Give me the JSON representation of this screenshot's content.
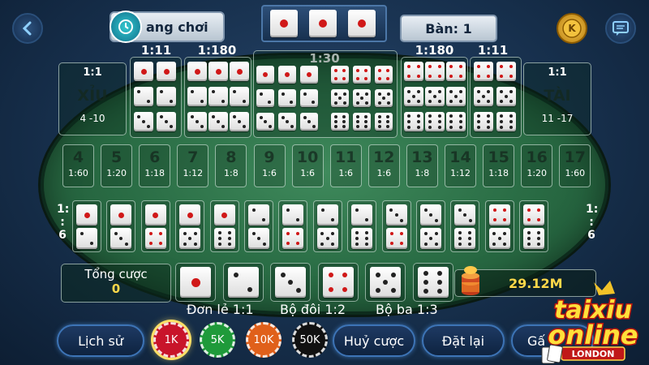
{
  "header": {
    "back_icon": "chevron-left-icon",
    "history_label": "ang chơi",
    "history_icon": "history-clock-icon",
    "table_label": "Bàn: 1",
    "coin_icon": "coin-k-icon",
    "chat_icon": "chat-icon",
    "result_dice": [
      1,
      1,
      1
    ]
  },
  "odds": {
    "small_big": "1:1",
    "doubles": "1:11",
    "triples": "1:180",
    "any_triple": "1:30",
    "left_single": "1:\n:\n6",
    "right_single": "1:\n:\n6"
  },
  "bets": {
    "xiu_label": "XỈU",
    "xiu_range": "4 -10",
    "tai_label": "TÀI",
    "tai_range": "11 -17",
    "doubles_left": [
      1,
      2
    ],
    "triples_left": [
      1,
      2
    ],
    "triples_right": [
      5,
      6
    ],
    "doubles_right": [
      5,
      6
    ],
    "any_triple_set": [
      1,
      2,
      3,
      4,
      5,
      6
    ]
  },
  "totals": [
    {
      "n": "4",
      "o": "1:60"
    },
    {
      "n": "5",
      "o": "1:20"
    },
    {
      "n": "6",
      "o": "1:18"
    },
    {
      "n": "7",
      "o": "1:12"
    },
    {
      "n": "8",
      "o": "1:8"
    },
    {
      "n": "9",
      "o": "1:6"
    },
    {
      "n": "10",
      "o": "1:6"
    },
    {
      "n": "11",
      "o": "1:6"
    },
    {
      "n": "12",
      "o": "1:6"
    },
    {
      "n": "13",
      "o": "1:8"
    },
    {
      "n": "14",
      "o": "1:12"
    },
    {
      "n": "15",
      "o": "1:18"
    },
    {
      "n": "16",
      "o": "1:20"
    },
    {
      "n": "17",
      "o": "1:60"
    }
  ],
  "combos": [
    [
      1,
      2
    ],
    [
      1,
      3
    ],
    [
      1,
      4
    ],
    [
      1,
      5
    ],
    [
      1,
      6
    ],
    [
      2,
      3
    ],
    [
      2,
      4
    ],
    [
      2,
      5
    ],
    [
      2,
      6
    ],
    [
      3,
      4
    ],
    [
      3,
      5
    ],
    [
      3,
      6
    ],
    [
      4,
      5
    ],
    [
      4,
      6
    ]
  ],
  "bottom": {
    "total_bet_label": "Tổng cược",
    "total_bet_value": "0",
    "single_dice": [
      1,
      2,
      3,
      4,
      5,
      6
    ],
    "balance": "29.12M",
    "chips_icon": "chip-stack-icon",
    "single_label": "Đơn lẻ 1:1",
    "pair_label": "Bộ đôi 1:2",
    "triple_label": "Bộ ba 1:3"
  },
  "footer": {
    "history_btn": "Lịch sử",
    "chips": [
      {
        "label": "1K",
        "color": "#c8142a"
      },
      {
        "label": "5K",
        "color": "#1f9a3a"
      },
      {
        "label": "10K",
        "color": "#e0601a"
      },
      {
        "label": "50K",
        "color": "#111111"
      }
    ],
    "cancel_btn": "Huỷ cược",
    "reset_btn": "Đặt lại",
    "last_btn": "Gấ"
  },
  "watermark": {
    "line1": "taixiu",
    "line2": "online",
    "line3": "LONDON"
  },
  "colors": {
    "accent_gold": "#ffd84a",
    "felt": "#2a6d45",
    "red_pip": "#d01818"
  }
}
